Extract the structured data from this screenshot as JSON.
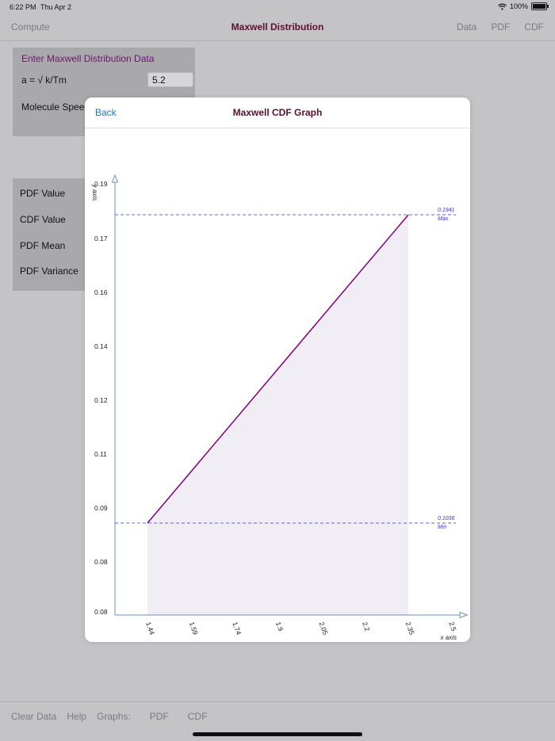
{
  "status_bar": {
    "time": "6:22 PM",
    "date": "Thu Apr 2",
    "battery": "100%",
    "battery_level": 1.0
  },
  "navbar": {
    "left_label": "Compute",
    "title": "Maxwell Distribution",
    "right_items": [
      "Data",
      "PDF",
      "CDF"
    ]
  },
  "input_panel": {
    "heading": "Enter Maxwell Distribution Data",
    "a_label": "a = √ k/Tm",
    "a_value": "5.2",
    "speed_label": "Molecule Speed"
  },
  "results": {
    "labels": [
      "PDF Value",
      "CDF Value",
      "PDF Mean",
      "PDF Variance"
    ]
  },
  "toolbar": {
    "items": [
      "Clear Data",
      "Help",
      "Graphs:",
      "PDF",
      "CDF"
    ]
  },
  "modal": {
    "back_label": "Back",
    "title": "Maxwell CDF Graph"
  },
  "colors": {
    "line": "#800080",
    "fill": "#f0eef4",
    "ref_line": "#3333dd",
    "axis": "#6a8fb8",
    "title": "#5a1030",
    "link": "#1a73d9"
  },
  "chart_data": {
    "type": "area",
    "x": [
      1.44,
      2.35
    ],
    "y": [
      0.1036,
      0.1941
    ],
    "xlabel": "x axis",
    "ylabel": "y axis",
    "x_ticks": [
      "1.44",
      "1.59",
      "1.74",
      "1.9",
      "2.05",
      "2.2",
      "2.35",
      "2.5"
    ],
    "y_ticks": [
      "0.19",
      "0.17",
      "0.16",
      "0.14",
      "0.12",
      "0.11",
      "0.09",
      "0.08",
      "0.08"
    ],
    "max_line": {
      "value_label": "0.1941",
      "label": "Max"
    },
    "min_line": {
      "value_label": "0.1036",
      "label": "Min"
    },
    "grid": false
  }
}
